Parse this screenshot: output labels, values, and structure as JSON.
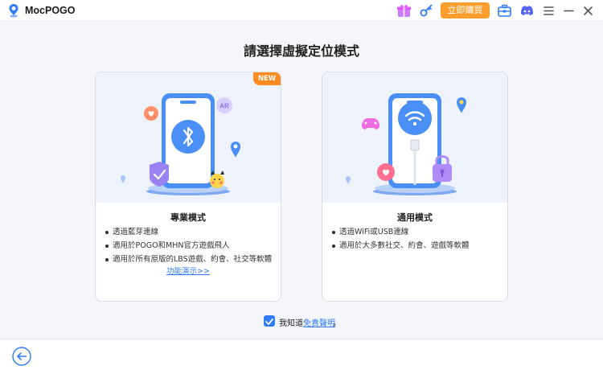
{
  "app": {
    "title": "MocPOGO"
  },
  "titlebar": {
    "buy_label": "立即購買",
    "icons": [
      "app-logo-icon",
      "gift-box-icon",
      "key-icon",
      "toolbox-icon",
      "discord-icon",
      "menu-icon",
      "minimize-icon",
      "close-icon"
    ]
  },
  "main": {
    "heading": "請選擇虛擬定位模式"
  },
  "cards": {
    "pro": {
      "badge": "NEW",
      "title": "專業模式",
      "features": [
        "透過藍芽連線",
        "適用於POGO和MHN官方遊戲飛人",
        "適用於所有原版的LBS遊戲、約會、社交等軟體"
      ],
      "link": "功能演示>>",
      "illustration_badge": "AR"
    },
    "general": {
      "title": "通用模式",
      "features": [
        "透過WiFi或USB連線",
        "適用於大多數社交、約會、遊戲等軟體"
      ]
    }
  },
  "agreement": {
    "checked": true,
    "text": "我知道",
    "link": "免責聲明",
    "suffix": "。"
  },
  "colors": {
    "accent": "#2f7cf6",
    "buy_button": "#ff9e2c",
    "new_badge": "#ff8a1f",
    "phone": "#4a8ff5"
  }
}
